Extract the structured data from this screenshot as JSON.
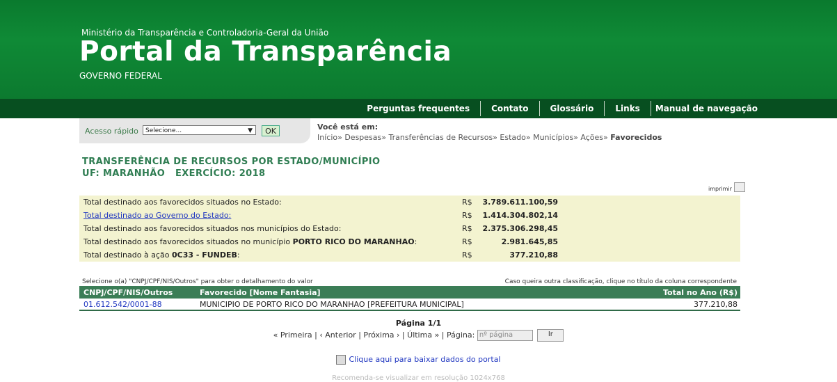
{
  "header": {
    "ministry": "Ministério da Transparência e Controladoria-Geral da União",
    "title": "Portal da Transparência",
    "gov": "GOVERNO FEDERAL"
  },
  "nav": [
    "Perguntas frequentes",
    "Contato",
    "Glossário",
    "Links",
    "Manual de navegação"
  ],
  "quick": {
    "label": "Acesso rápido",
    "select_value": "Selecione...",
    "ok": "OK"
  },
  "breadcrumb": {
    "you": "Você está em:",
    "items": "Início» Despesas» Transferências de Recursos» Estado» Municípios» Ações»",
    "current": "Favorecidos"
  },
  "page": {
    "title": "TRANSFERÊNCIA DE RECURSOS POR ESTADO/MUNICÍPIO",
    "subtitle": "UF: MARANHÃO   EXERCÍCIO: 2018",
    "print": "imprimir"
  },
  "totals": [
    {
      "label": "Total destinado aos favorecidos situados no Estado:",
      "cur": "R$",
      "value": "3.789.611.100,59"
    },
    {
      "label": "Total destinado ao Governo do Estado:",
      "cur": "R$",
      "value": "1.414.304.802,14"
    },
    {
      "label": "Total destinado aos favorecidos situados nos municípios do Estado:",
      "cur": "R$",
      "value": "2.375.306.298,45"
    },
    {
      "label": "Total destinado aos favorecidos situados no município",
      "bold": "PORTO RICO DO MARANHAO",
      "suffix": ":",
      "cur": "R$",
      "value": "2.981.645,85"
    },
    {
      "label": "Total destinado à ação",
      "bold": "0C33 - FUNDEB",
      "suffix": ":",
      "cur": "R$",
      "value": "377.210,88"
    }
  ],
  "notes": {
    "left": "Selecione o(a) \"CNPJ/CPF/NIS/Outros\" para obter o detalhamento do valor",
    "right": "Caso queira outra classificação, clique no título da coluna correspondente"
  },
  "table": {
    "headers": [
      "CNPJ/CPF/NIS/Outros",
      "Favorecido [Nome Fantasia]",
      "Total no Ano (R$)"
    ],
    "rows": [
      {
        "id": "01.612.542/0001-88",
        "name": "MUNICIPIO DE PORTO RICO DO MARANHAO [PREFEITURA MUNICIPAL]",
        "total": "377.210,88"
      }
    ]
  },
  "pager": {
    "page": "Página 1/1",
    "first": "« Primeira",
    "prev": "‹ Anterior",
    "next": "Próxima ›",
    "last": "Última »",
    "page_label": "Página:",
    "placeholder": "nº página",
    "go": "Ir"
  },
  "download": "Clique aqui para baixar dados do portal",
  "footer_note": "Recomenda-se visualizar em resolução 1024x768"
}
